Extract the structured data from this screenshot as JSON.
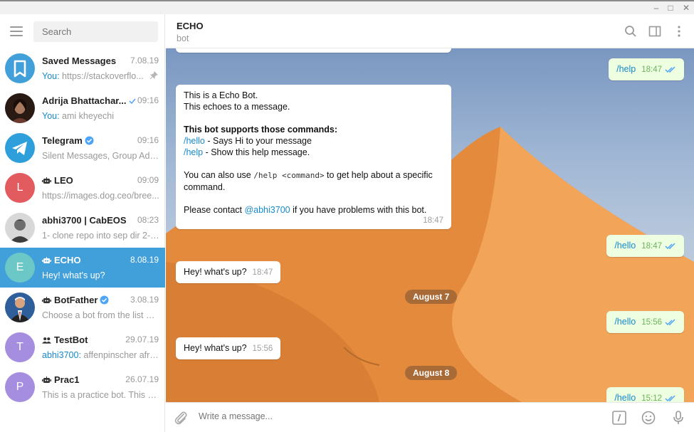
{
  "window": {
    "minimize": "–",
    "maximize": "□",
    "close": "✕"
  },
  "sidebar": {
    "search_placeholder": "Search",
    "chats": [
      {
        "name": "Saved Messages",
        "time": "7.08.19",
        "you": "You:",
        "preview": " https://stackoverflo...",
        "avatar_color": "#419fd9",
        "icon": "bookmark-icon",
        "pinned": true
      },
      {
        "name": "Adrija Bhattachar...",
        "time": "09:16",
        "you": "You:",
        "preview": " ami kheyechi",
        "avatar_color": "#5a3a2a",
        "icon": "photo",
        "read": true
      },
      {
        "name": "Telegram",
        "time": "09:16",
        "you": "",
        "preview": "Silent Messages, Group Admi...",
        "avatar_color": "#2f9fdc",
        "icon": "telegram-icon",
        "verified": true
      },
      {
        "name": "LEO",
        "time": "09:09",
        "you": "",
        "preview": "https://images.dog.ceo/bree...",
        "avatar_color": "#e25b5f",
        "letter": "L",
        "bot": true
      },
      {
        "name": "abhi3700 | CabEOS",
        "time": "08:23",
        "you": "",
        "preview": "1- clone repo into sep dir 2- b...",
        "avatar_color": "#7a7a7a",
        "icon": "photo"
      },
      {
        "name": "ECHO",
        "time": "8.08.19",
        "you": "",
        "preview": "Hey! what's up?",
        "avatar_color": "#6cc7c7",
        "letter": "E",
        "bot": true,
        "active": true
      },
      {
        "name": "BotFather",
        "time": "3.08.19",
        "you": "",
        "preview": "Choose a bot from the list be...",
        "avatar_color": "#2f6aa8",
        "icon": "photo",
        "bot": true,
        "verified": true
      },
      {
        "name": "TestBot",
        "time": "29.07.19",
        "you": "abhi3700:",
        "preview": " affenpinscher afric...",
        "avatar_color": "#a58ee0",
        "letter": "T",
        "group": true
      },
      {
        "name": "Prac1",
        "time": "26.07.19",
        "you": "",
        "preview": "This is a practice bot.  This bo...",
        "avatar_color": "#a58ee0",
        "letter": "P",
        "bot": true
      }
    ]
  },
  "header": {
    "title": "ECHO",
    "subtitle": "bot"
  },
  "messages": {
    "m1": {
      "text": "/help",
      "time": "18:47"
    },
    "m2": {
      "line1": "This is a Echo Bot.",
      "line2": "This echoes to a message.",
      "bold": "This bot supports those commands:",
      "c1": "/hello",
      "c1_desc": " - Says Hi to your message",
      "c2": "/help",
      "c2_desc": " - Show this help message.",
      "use_pre": "You can also use ",
      "use_code": "/help <command>",
      "use_post": " to get help about a specific",
      "use_line2": "command.",
      "contact_pre": "Please contact ",
      "contact_link": "@abhi3700",
      "contact_post": " if you have problems with this bot.",
      "time": "18:47"
    },
    "m3": {
      "text": "/hello",
      "time": "18:47"
    },
    "m4": {
      "text": "Hey! what's up?",
      "time": "18:47"
    },
    "date1": "August 7",
    "m5": {
      "text": "/hello",
      "time": "15:56"
    },
    "m6": {
      "text": "Hey! what's up?",
      "time": "15:56"
    },
    "date2": "August 8",
    "m7": {
      "text": "/hello",
      "time": "15:12"
    }
  },
  "composer": {
    "placeholder": "Write a message..."
  }
}
